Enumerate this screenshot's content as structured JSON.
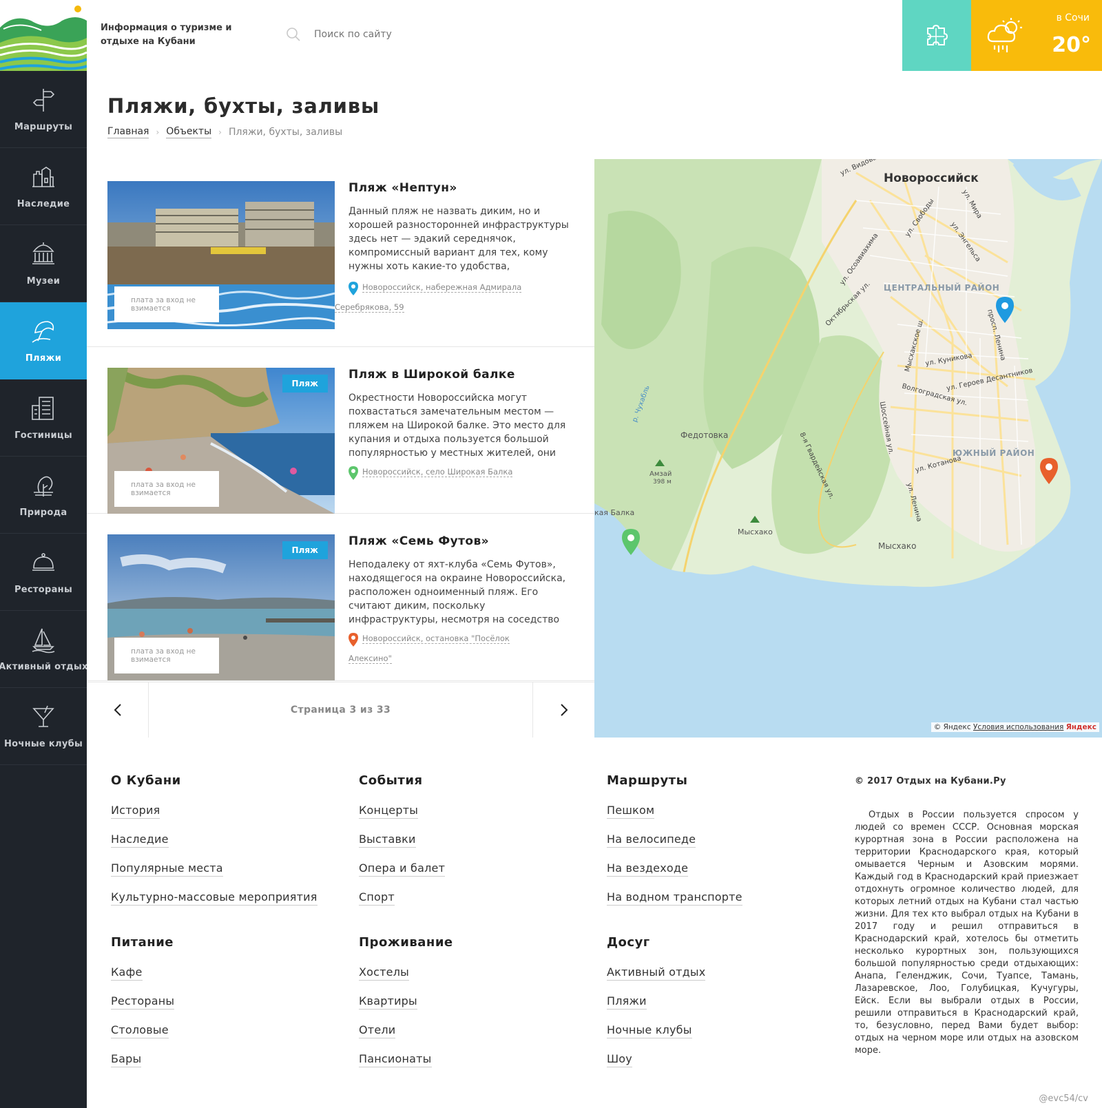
{
  "header": {
    "tagline": "Информация о туризме и отдыхе на Кубани",
    "search_placeholder": "Поиск по сайту",
    "weather": {
      "city": "в Сочи",
      "temp": "20°"
    }
  },
  "sidebar": {
    "items": [
      {
        "label": "Маршруты",
        "icon": "signpost-icon"
      },
      {
        "label": "Наследие",
        "icon": "castle-icon"
      },
      {
        "label": "Музеи",
        "icon": "museum-icon"
      },
      {
        "label": "Пляжи",
        "icon": "beach-umbrella-icon",
        "active": true
      },
      {
        "label": "Гостиницы",
        "icon": "hotel-icon"
      },
      {
        "label": "Природа",
        "icon": "nature-icon"
      },
      {
        "label": "Рестораны",
        "icon": "cloche-icon"
      },
      {
        "label": "Активный отдых",
        "icon": "sailboat-icon"
      },
      {
        "label": "Ночные клубы",
        "icon": "cocktail-icon"
      }
    ]
  },
  "page": {
    "title": "Пляжи, бухты, заливы",
    "breadcrumb": [
      "Главная",
      "Объекты",
      "Пляжи, бухты, заливы"
    ]
  },
  "listing": [
    {
      "title": "Пляж «Нептун»",
      "desc": "Данный пляж не назвать диким, но и хорошей разносторонней инфраструктуры здесь нет — эдакий середнячок, компромиссный вариант для тех, кому нужны хоть какие-то удобства,",
      "address_line1": "Новороссийск, набережная Адмирала",
      "address_line2": "Серебрякова, 59",
      "fee": "плата за вход не взимается",
      "badge": "",
      "pin_color": "#1fa3dc"
    },
    {
      "title": "Пляж в Широкой балке",
      "desc": "Окрестности Новороссийска могут похвастаться замечательным местом — пляжем на Широкой балке. Это место для купания и отдыха пользуется большой популярностью у местных жителей, они",
      "address_line1": "Новороссийск, село Широкая Балка",
      "address_line2": "",
      "fee": "плата за вход не взимается",
      "badge": "Пляж",
      "pin_color": "#5cc66c"
    },
    {
      "title": "Пляж «Семь Футов»",
      "desc": "Неподалеку от яхт-клуба «Семь Футов», находящегося на окраине Новороссийска, расположен одноименный пляж. Его считают диким, поскольку инфраструктуры, несмотря на соседство",
      "address_line1": "Новороссийск, остановка \"Посёлок Алексино\"",
      "address_line2": "",
      "fee": "плата за вход не взимается",
      "badge": "Пляж",
      "pin_color": "#e8602c"
    }
  ],
  "pager": {
    "text": "Страница 3 из 33"
  },
  "map": {
    "city": "Новороссийск",
    "districts": [
      "ЦЕНТРАЛЬНЫЙ РАЙОН",
      "ЮЖНЫЙ РАЙОН"
    ],
    "places": [
      "Федотовка",
      "Мысхако",
      "Мысхако",
      "Амзай",
      "398 м",
      "кая Балка"
    ],
    "streets": [
      "ул. Видова",
      "ул. Мира",
      "ул. Свободы",
      "ул. Энгельса",
      "ул. Осоавиахима",
      "Октябрьская ул.",
      "просп. Ленина",
      "Мысхакское ш.",
      "ул. Куникова",
      "ул. Героев Десантников",
      "Волгоградская ул.",
      "р. Чухабль",
      "Шоссейная ул.",
      "8-я Гвардейская ул.",
      "ул. Котанова",
      "ул. Ленина"
    ],
    "attribution": "© Яндекс",
    "terms": "Условия использования",
    "brand": "Яндекс"
  },
  "footer": {
    "columns": [
      {
        "title": "О Кубани",
        "links": [
          "История",
          "Наследие",
          "Популярные места",
          "Культурно-массовые мероприятия"
        ]
      },
      {
        "title": "События",
        "links": [
          "Концерты",
          "Выставки",
          "Опера и балет",
          "Спорт"
        ]
      },
      {
        "title": "Маршруты",
        "links": [
          "Пешком",
          "На велосипеде",
          "На вездеходе",
          "На водном транспорте"
        ]
      },
      {
        "title": "Питание",
        "links": [
          "Кафе",
          "Рестораны",
          "Столовые",
          "Бары"
        ]
      },
      {
        "title": "Проживание",
        "links": [
          "Хостелы",
          "Квартиры",
          "Отели",
          "Пансионаты"
        ]
      },
      {
        "title": "Досуг",
        "links": [
          "Активный отдых",
          "Пляжи",
          "Ночные клубы",
          "Шоу"
        ]
      }
    ],
    "copyright": "© 2017 Отдых на Кубани.Ру",
    "about": "Отдых в России пользуется спросом у людей со времен СССР. Основная морская курортная зона в России расположена на территории Краснодарского края, который омывается Черным и Азовским морями. Каждый год в Краснодарский край приезжает отдохнуть огромное количество людей, для которых летний отдых на Кубани стал частью жизни. Для тех кто выбрал отдых на Кубани в 2017 году и решил отправиться в Краснодарский край, хотелось бы отметить несколько курортных зон, пользующихся большой популярностью среди отдыхающих: Анапа, Геленджик, Сочи, Туапсе, Тамань, Лазаревское, Лоо, Голубицкая, Кучугуры, Ейск. Если вы выбрали отдых в России, решили отправиться в Краснодарский край, то, безусловно, перед Вами будет выбор: отдых на черном море или отдых на азовском море.",
    "signature": "@evc54/cv"
  },
  "colors": {
    "accent": "#1fa3dc",
    "sidebar": "#1f242b",
    "teal": "#5fd6c2",
    "weather": "#f9bb0b"
  }
}
